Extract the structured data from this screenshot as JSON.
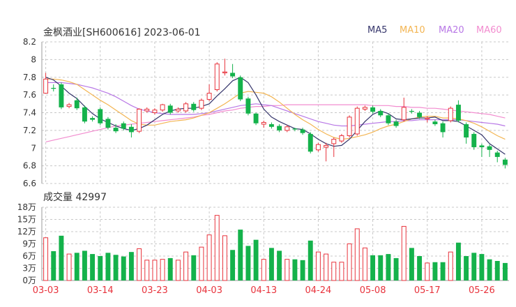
{
  "header": {
    "title": "金枫酒业[SH600616] 2023-06-01",
    "legend": [
      {
        "label": "MA5",
        "color": "#35356b"
      },
      {
        "label": "MA10",
        "color": "#f3b552"
      },
      {
        "label": "MA20",
        "color": "#b878e6"
      },
      {
        "label": "MA60",
        "color": "#f28ccf"
      }
    ]
  },
  "volume_panel": {
    "title": "成交量 42997"
  },
  "colors": {
    "up": "#e8333c",
    "down": "#14b24b",
    "grid": "#c8c8c8",
    "axis_text": "#333333",
    "date_text": "#e8333c"
  },
  "chart_data": [
    {
      "type": "candlestick",
      "ylim": [
        6.6,
        8.2
      ],
      "y_ticks": [
        "8.2",
        "8",
        "7.8",
        "7.6",
        "7.4",
        "7.2",
        "7",
        "6.8",
        "6.6"
      ],
      "x_ticks": [
        "03-03",
        "03-14",
        "03-23",
        "04-03",
        "04-13",
        "04-24",
        "05-08",
        "05-17",
        "05-26"
      ],
      "x_tick_index": [
        0,
        7,
        14,
        21,
        28,
        35,
        42,
        49,
        56
      ],
      "ohlc": [
        [
          7.62,
          7.78,
          7.62,
          7.85
        ],
        [
          7.68,
          7.67,
          7.64,
          7.72
        ],
        [
          7.72,
          7.46,
          7.44,
          7.74
        ],
        [
          7.47,
          7.49,
          7.45,
          7.51
        ],
        [
          7.54,
          7.45,
          7.43,
          7.57
        ],
        [
          7.46,
          7.3,
          7.28,
          7.48
        ],
        [
          7.34,
          7.32,
          7.3,
          7.36
        ],
        [
          7.44,
          7.28,
          7.26,
          7.46
        ],
        [
          7.33,
          7.23,
          7.21,
          7.35
        ],
        [
          7.23,
          7.19,
          7.17,
          7.27
        ],
        [
          7.28,
          7.22,
          7.2,
          7.3
        ],
        [
          7.24,
          7.18,
          7.12,
          7.27
        ],
        [
          7.19,
          7.44,
          7.17,
          7.45
        ],
        [
          7.42,
          7.44,
          7.4,
          7.46
        ],
        [
          7.4,
          7.43,
          7.38,
          7.45
        ],
        [
          7.43,
          7.49,
          7.41,
          7.5
        ],
        [
          7.48,
          7.4,
          7.38,
          7.5
        ],
        [
          7.42,
          7.44,
          7.4,
          7.46
        ],
        [
          7.42,
          7.5,
          7.4,
          7.52
        ],
        [
          7.5,
          7.43,
          7.41,
          7.52
        ],
        [
          7.45,
          7.54,
          7.43,
          7.56
        ],
        [
          7.55,
          7.62,
          7.53,
          7.72
        ],
        [
          7.66,
          7.95,
          7.64,
          7.97
        ],
        [
          7.85,
          7.86,
          7.82,
          8.01
        ],
        [
          7.85,
          7.81,
          7.79,
          7.95
        ],
        [
          7.8,
          7.55,
          7.53,
          7.82
        ],
        [
          7.56,
          7.39,
          7.37,
          7.58
        ],
        [
          7.39,
          7.28,
          7.26,
          7.4
        ],
        [
          7.27,
          7.29,
          7.23,
          7.31
        ],
        [
          7.27,
          7.24,
          7.22,
          7.29
        ],
        [
          7.25,
          7.2,
          7.18,
          7.27
        ],
        [
          7.2,
          7.24,
          7.18,
          7.26
        ],
        [
          7.22,
          7.21,
          7.19,
          7.23
        ],
        [
          7.21,
          7.17,
          7.15,
          7.23
        ],
        [
          7.16,
          6.96,
          6.94,
          7.18
        ],
        [
          6.98,
          7.04,
          6.96,
          7.06
        ],
        [
          7.01,
          7.03,
          6.85,
          7.06
        ],
        [
          7.05,
          7.1,
          6.9,
          7.12
        ],
        [
          7.08,
          7.14,
          7.06,
          7.16
        ],
        [
          7.14,
          7.35,
          7.12,
          7.37
        ],
        [
          7.16,
          7.45,
          7.14,
          7.47
        ],
        [
          7.44,
          7.46,
          7.42,
          7.48
        ],
        [
          7.46,
          7.41,
          7.39,
          7.48
        ],
        [
          7.42,
          7.37,
          7.35,
          7.44
        ],
        [
          7.37,
          7.28,
          7.26,
          7.39
        ],
        [
          7.3,
          7.25,
          7.23,
          7.32
        ],
        [
          7.32,
          7.46,
          7.3,
          7.57
        ],
        [
          7.42,
          7.41,
          7.39,
          7.44
        ],
        [
          7.4,
          7.35,
          7.33,
          7.42
        ],
        [
          7.33,
          7.34,
          7.29,
          7.36
        ],
        [
          7.3,
          7.27,
          7.25,
          7.32
        ],
        [
          7.28,
          7.18,
          7.12,
          7.3
        ],
        [
          7.31,
          7.45,
          7.29,
          7.47
        ],
        [
          7.49,
          7.31,
          7.29,
          7.54
        ],
        [
          7.27,
          7.12,
          7.05,
          7.29
        ],
        [
          7.16,
          7.01,
          6.98,
          7.18
        ],
        [
          7.03,
          7.01,
          6.9,
          7.05
        ],
        [
          7.02,
          6.98,
          6.9,
          7.04
        ],
        [
          6.95,
          6.9,
          6.84,
          6.97
        ],
        [
          6.87,
          6.81,
          6.77,
          6.89
        ]
      ],
      "ma5": [
        7.8,
        7.77,
        7.7,
        7.62,
        7.56,
        7.47,
        7.39,
        7.33,
        7.29,
        7.25,
        7.22,
        7.2,
        7.22,
        7.26,
        7.32,
        7.38,
        7.42,
        7.44,
        7.45,
        7.45,
        7.47,
        7.5,
        7.59,
        7.67,
        7.76,
        7.8,
        7.74,
        7.6,
        7.44,
        7.35,
        7.3,
        7.26,
        7.22,
        7.21,
        7.16,
        7.1,
        7.05,
        7.02,
        7.03,
        7.1,
        7.2,
        7.3,
        7.38,
        7.42,
        7.39,
        7.33,
        7.32,
        7.33,
        7.34,
        7.34,
        7.35,
        7.31,
        7.31,
        7.3,
        7.25,
        7.2,
        7.15,
        7.05,
        6.99,
        6.93
      ],
      "ma10": [
        7.78,
        7.78,
        7.77,
        7.75,
        7.72,
        7.66,
        7.6,
        7.54,
        7.49,
        7.43,
        7.37,
        7.31,
        7.27,
        7.26,
        7.26,
        7.28,
        7.3,
        7.31,
        7.32,
        7.34,
        7.37,
        7.4,
        7.45,
        7.5,
        7.56,
        7.62,
        7.64,
        7.63,
        7.62,
        7.58,
        7.52,
        7.45,
        7.38,
        7.32,
        7.27,
        7.21,
        7.16,
        7.12,
        7.1,
        7.11,
        7.13,
        7.15,
        7.18,
        7.22,
        7.25,
        7.27,
        7.3,
        7.33,
        7.35,
        7.36,
        7.36,
        7.34,
        7.34,
        7.33,
        7.31,
        7.28,
        7.24,
        7.19,
        7.14,
        7.1
      ],
      "ma20": [
        7.74,
        7.74,
        7.74,
        7.73,
        7.72,
        7.7,
        7.68,
        7.65,
        7.62,
        7.58,
        7.53,
        7.48,
        7.44,
        7.42,
        7.4,
        7.39,
        7.38,
        7.38,
        7.38,
        7.38,
        7.39,
        7.4,
        7.42,
        7.44,
        7.46,
        7.48,
        7.49,
        7.5,
        7.49,
        7.48,
        7.45,
        7.42,
        7.39,
        7.36,
        7.33,
        7.3,
        7.28,
        7.26,
        7.25,
        7.25,
        7.26,
        7.27,
        7.28,
        7.29,
        7.3,
        7.3,
        7.31,
        7.31,
        7.32,
        7.32,
        7.32,
        7.32,
        7.32,
        7.32,
        7.31,
        7.3,
        7.29,
        7.28,
        7.27,
        7.25
      ],
      "ma60": [
        7.07,
        7.09,
        7.11,
        7.13,
        7.15,
        7.17,
        7.19,
        7.21,
        7.23,
        7.25,
        7.26,
        7.27,
        7.28,
        7.29,
        7.3,
        7.31,
        7.32,
        7.33,
        7.34,
        7.35,
        7.37,
        7.38,
        7.4,
        7.42,
        7.43,
        7.45,
        7.46,
        7.47,
        7.47,
        7.48,
        7.48,
        7.49,
        7.49,
        7.49,
        7.49,
        7.49,
        7.49,
        7.49,
        7.49,
        7.49,
        7.49,
        7.49,
        7.48,
        7.48,
        7.48,
        7.47,
        7.47,
        7.46,
        7.46,
        7.45,
        7.45,
        7.44,
        7.43,
        7.42,
        7.41,
        7.4,
        7.39,
        7.38,
        7.36,
        7.34
      ]
    },
    {
      "type": "bar",
      "ylim": [
        0,
        18
      ],
      "y_ticks": [
        "18万",
        "15万",
        "12万",
        "9万",
        "6万",
        "3万",
        "0万"
      ],
      "volume_wan": [
        10.5,
        7.2,
        11.0,
        6.5,
        6.8,
        7.3,
        6.5,
        6.0,
        6.8,
        6.3,
        5.9,
        7.0,
        7.8,
        5.0,
        5.0,
        5.2,
        5.5,
        5.0,
        7.0,
        6.2,
        8.2,
        11.2,
        16.0,
        11.0,
        7.5,
        12.5,
        8.5,
        10.0,
        5.2,
        8.0,
        7.3,
        5.2,
        5.2,
        5.0,
        9.8,
        7.0,
        6.5,
        4.5,
        4.5,
        9.0,
        12.7,
        8.0,
        6.2,
        6.2,
        6.5,
        5.5,
        13.3,
        8.0,
        6.0,
        4.3,
        4.5,
        4.5,
        7.0,
        9.3,
        6.0,
        6.8,
        6.5,
        5.2,
        4.8,
        4.3
      ]
    }
  ]
}
